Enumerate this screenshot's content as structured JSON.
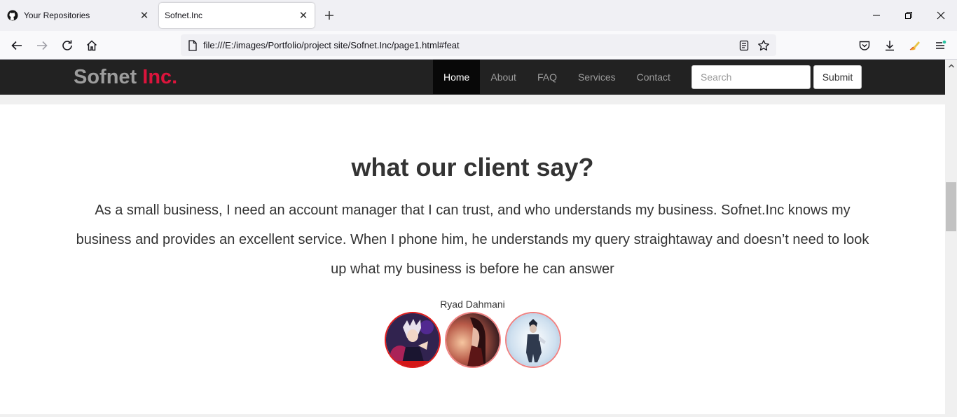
{
  "browser": {
    "tabs": [
      {
        "title": "Your Repositories",
        "icon": "github-icon",
        "active": false
      },
      {
        "title": "Sofnet.Inc",
        "icon": "",
        "active": true
      }
    ],
    "url": "file:///E:/images/Portfolio/project site/Sofnet.Inc/page1.html#feat"
  },
  "site": {
    "brand": {
      "name": "Sofnet",
      "accent": "Inc."
    },
    "menu": [
      "Home",
      "About",
      "FAQ",
      "Services",
      "Contact"
    ],
    "active_menu": "Home",
    "search": {
      "placeholder": "Search"
    },
    "submit_label": "Submit"
  },
  "testimonial": {
    "heading": "what our client say?",
    "quote": "As a small business, I need an account manager that I can trust, and who understands my business. Sofnet.Inc knows my business and provides an excellent service. When I phone him, he understands my query straightaway and doesn’t need to look up what my business is before he can answer",
    "author": "Ryad Dahmani",
    "avatars": [
      "avatar-anime-character",
      "avatar-red-haired-character",
      "avatar-snow-character"
    ]
  },
  "colors": {
    "accent": "#dc143c",
    "navbar_bg": "#222222",
    "avatar_border": "#f08080",
    "avatar_selected_border": "#e31b1b"
  }
}
